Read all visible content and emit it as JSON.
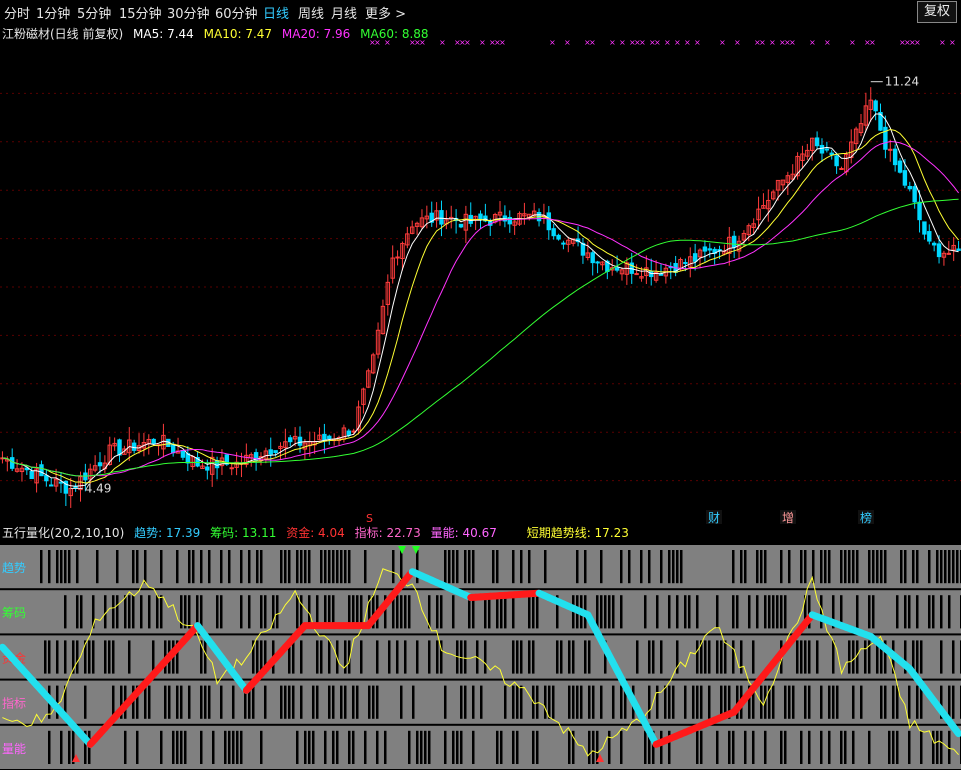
{
  "toolbar": {
    "tabs": [
      "分时",
      "1分钟",
      "5分钟",
      "15分钟",
      "30分钟",
      "60分钟",
      "日线",
      "周线",
      "月线",
      "更多 >"
    ],
    "active_tab": "日线",
    "fuquan_button": "复权"
  },
  "main_header": {
    "title": "江粉磁材(日线 前复权)",
    "ma5": "MA5: 7.44",
    "ma10": "MA10: 7.47",
    "ma20": "MA20: 7.96",
    "ma60": "MA60: 8.88"
  },
  "sub_header": {
    "title": "五行量化(20,2,10,10)",
    "qushi": "趋势: 17.39",
    "chouma": "筹码: 13.11",
    "zijin": "资金: 4.04",
    "zhibiao": "指标: 22.73",
    "liangneng": "量能: 40.67",
    "short_trend": "短期趋势线: 17.23"
  },
  "annotations": {
    "high_label": "11.24",
    "low_label": "4.49",
    "event_cai": "财",
    "event_zeng": "增",
    "event_bang": "榜",
    "s_marker": "S"
  },
  "band_labels": [
    "趋势",
    "筹码",
    "资金",
    "指标",
    "量能"
  ],
  "colors": {
    "up": "#ff3c3c",
    "down": "#00d8ff",
    "ma5": "#ffffff",
    "ma10": "#ffff33",
    "ma20": "#ff33ff",
    "ma60": "#33ff33",
    "trend_up": "#ff1a1a",
    "trend_down": "#22e0ee",
    "short_line": "#ffff33",
    "band_bg": "#808080"
  },
  "chart_data": [
    {
      "type": "candlestick",
      "title": "江粉磁材(日线 前复权)",
      "ylim": [
        4.0,
        11.6
      ],
      "series_names": [
        "MA5",
        "MA10",
        "MA20",
        "MA60"
      ],
      "ohlc_keypoints": [
        {
          "day": 0,
          "close": 5.0
        },
        {
          "day": 10,
          "close": 4.6
        },
        {
          "day": 14,
          "close": 4.49
        },
        {
          "day": 22,
          "close": 5.1
        },
        {
          "day": 32,
          "close": 5.3
        },
        {
          "day": 40,
          "close": 4.9
        },
        {
          "day": 48,
          "close": 4.9
        },
        {
          "day": 56,
          "close": 5.2
        },
        {
          "day": 66,
          "close": 5.3
        },
        {
          "day": 72,
          "close": 5.5
        },
        {
          "day": 76,
          "close": 6.6
        },
        {
          "day": 80,
          "close": 8.3
        },
        {
          "day": 84,
          "close": 8.9
        },
        {
          "day": 90,
          "close": 9.0
        },
        {
          "day": 96,
          "close": 8.9
        },
        {
          "day": 104,
          "close": 9.0
        },
        {
          "day": 110,
          "close": 9.0
        },
        {
          "day": 116,
          "close": 8.6
        },
        {
          "day": 124,
          "close": 8.2
        },
        {
          "day": 134,
          "close": 8.1
        },
        {
          "day": 142,
          "close": 8.3
        },
        {
          "day": 150,
          "close": 8.6
        },
        {
          "day": 158,
          "close": 9.4
        },
        {
          "day": 166,
          "close": 10.2
        },
        {
          "day": 172,
          "close": 9.8
        },
        {
          "day": 178,
          "close": 10.9
        },
        {
          "day": 182,
          "close": 10.0
        },
        {
          "day": 186,
          "close": 9.4
        },
        {
          "day": 190,
          "close": 8.5
        },
        {
          "day": 194,
          "close": 8.4
        }
      ],
      "high": 11.24,
      "low": 4.49
    },
    {
      "type": "line",
      "title": "五行量化(20,2,10,10)",
      "ylim": [
        0,
        100
      ],
      "series": [
        {
          "name": "趋势",
          "values_keypoints": [
            [
              0,
              55
            ],
            [
              18,
              10
            ],
            [
              40,
              65
            ],
            [
              50,
              35
            ],
            [
              62,
              65
            ],
            [
              75,
              65
            ],
            [
              84,
              90
            ],
            [
              96,
              78
            ],
            [
              110,
              80
            ],
            [
              120,
              70
            ],
            [
              134,
              10
            ],
            [
              150,
              25
            ],
            [
              166,
              70
            ],
            [
              172,
              65
            ],
            [
              178,
              60
            ],
            [
              186,
              45
            ],
            [
              196,
              15
            ]
          ]
        },
        {
          "name": "短期趋势线",
          "values_keypoints": [
            [
              0,
              20
            ],
            [
              10,
              22
            ],
            [
              20,
              70
            ],
            [
              30,
              85
            ],
            [
              40,
              60
            ],
            [
              44,
              40
            ],
            [
              50,
              50
            ],
            [
              60,
              80
            ],
            [
              70,
              45
            ],
            [
              78,
              90
            ],
            [
              84,
              85
            ],
            [
              90,
              55
            ],
            [
              100,
              45
            ],
            [
              110,
              30
            ],
            [
              120,
              5
            ],
            [
              130,
              20
            ],
            [
              146,
              65
            ],
            [
              156,
              30
            ],
            [
              166,
              85
            ],
            [
              172,
              45
            ],
            [
              180,
              60
            ],
            [
              186,
              20
            ],
            [
              196,
              5
            ]
          ]
        }
      ]
    }
  ]
}
